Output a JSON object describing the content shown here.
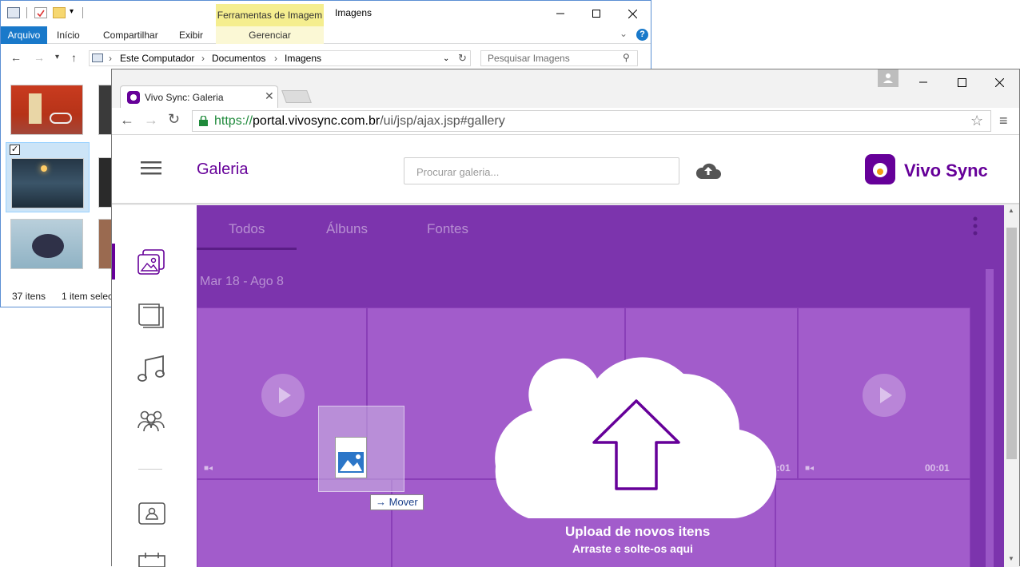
{
  "explorer": {
    "title": "Imagens",
    "ctx_tab_header": "Ferramentas de Imagem",
    "tabs": [
      {
        "label": "Arquivo"
      },
      {
        "label": "Início"
      },
      {
        "label": "Compartilhar"
      },
      {
        "label": "Exibir"
      },
      {
        "label": "Gerenciar"
      }
    ],
    "breadcrumb": [
      "Este Computador",
      "Documentos",
      "Imagens"
    ],
    "search_placeholder": "Pesquisar Imagens",
    "status_count": "37 itens",
    "status_selected": "1 item selec"
  },
  "browser": {
    "tab_title": "Vivo Sync: Galeria",
    "url_scheme": "https://",
    "url_host": "portal.vivosync.com.br",
    "url_path": "/ui/jsp/ajax.jsp#gallery"
  },
  "app": {
    "page_title": "Galeria",
    "search_placeholder": "Procurar galeria...",
    "brand_name": "Vivo Sync",
    "tabs": [
      {
        "label": "Todos"
      },
      {
        "label": "Álbuns"
      },
      {
        "label": "Fontes"
      }
    ],
    "date_range": "Mar 18 - Ago 8",
    "durations": [
      "00:01",
      "00:01"
    ],
    "upload_title": "Upload de novos itens",
    "upload_subtitle": "Arraste e solte-os aqui",
    "drag_action": "Mover",
    "colors": {
      "brand": "#660099",
      "overlay": "#7c34ad",
      "ribbon_accent": "#1979ca"
    }
  }
}
